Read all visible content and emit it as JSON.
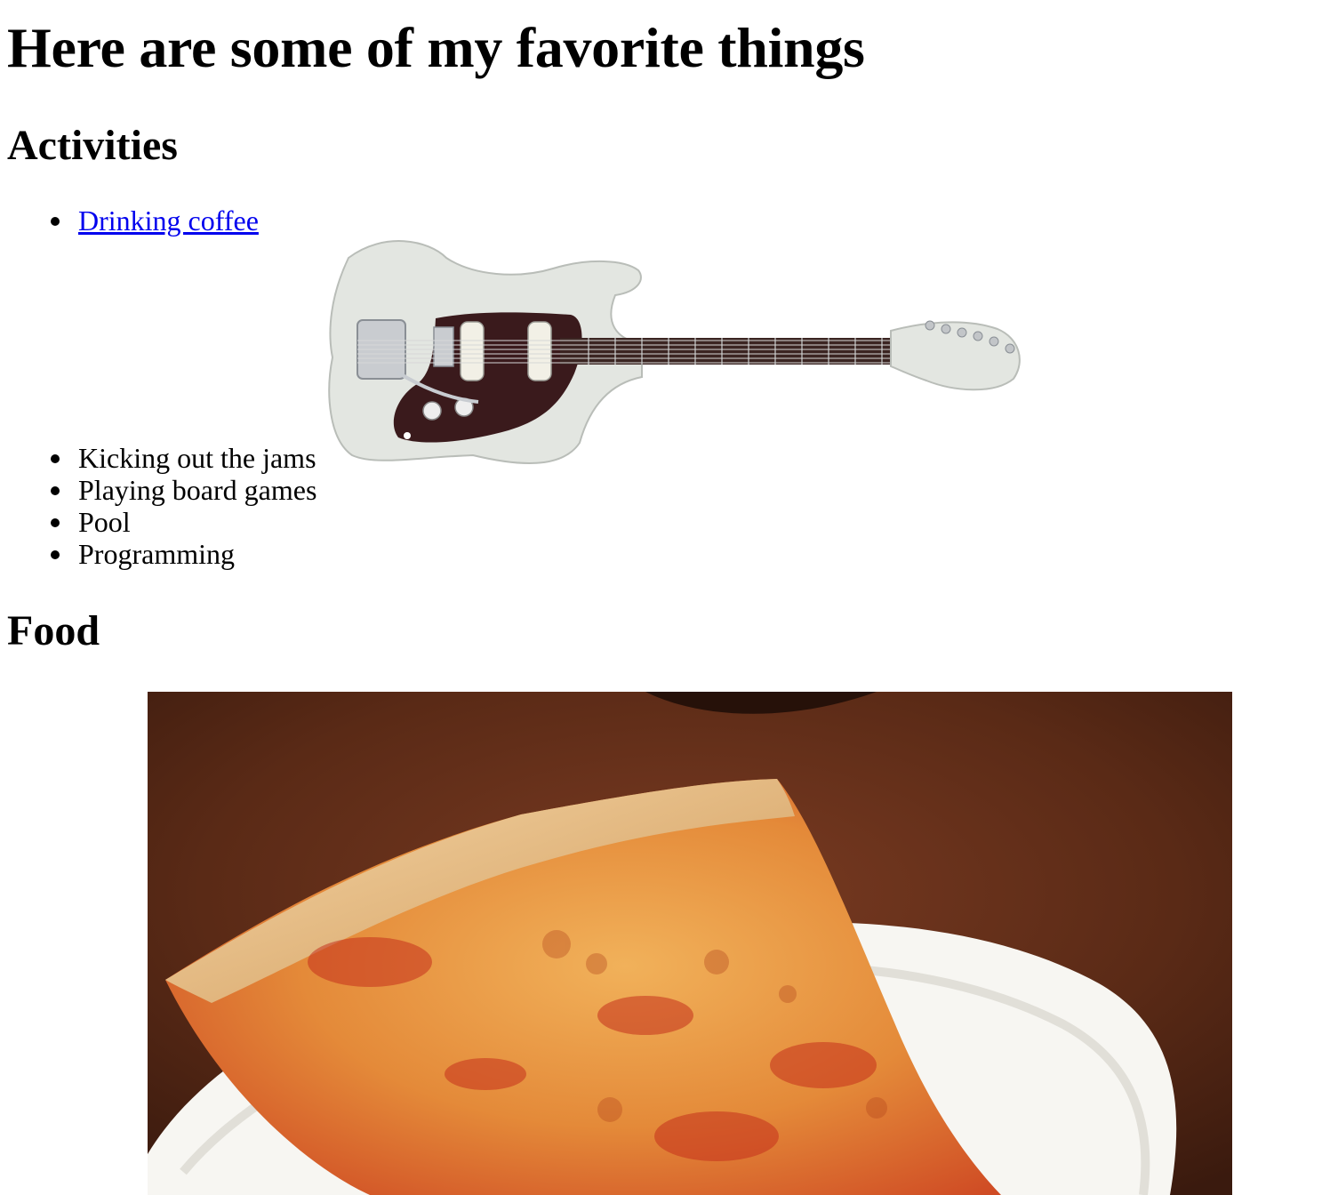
{
  "page": {
    "title": "Here are some of my favorite things"
  },
  "activities": {
    "heading": "Activities",
    "link_item": "Drinking coffee",
    "items": [
      "Kicking out the jams",
      "Playing board games",
      "Pool",
      "Programming"
    ]
  },
  "food": {
    "heading": "Food"
  },
  "colors": {
    "link": "#0000ee",
    "text": "#000000",
    "background": "#ffffff"
  },
  "images": {
    "guitar": "electric-guitar-image",
    "pizza": "pizza-slice-image"
  }
}
